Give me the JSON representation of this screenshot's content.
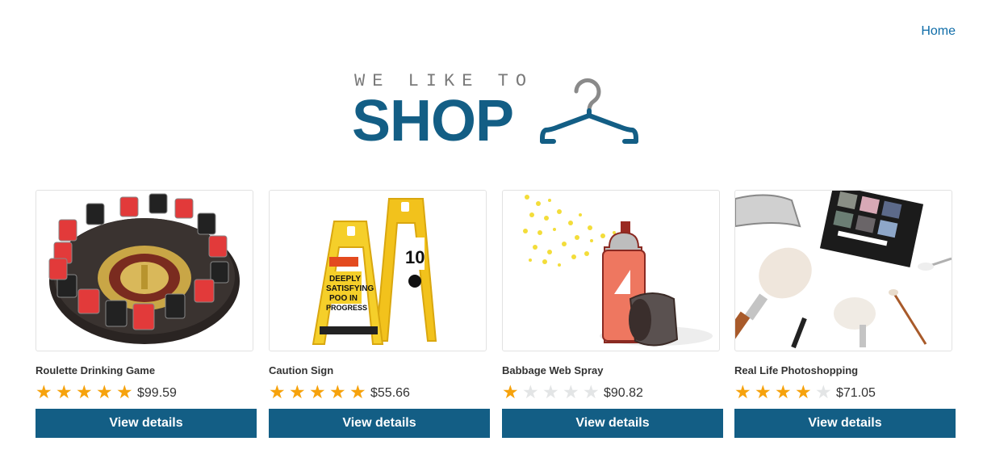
{
  "nav": {
    "home_label": "Home"
  },
  "logo": {
    "tagline": "WE LIKE TO",
    "wordmark": "SHOP",
    "color": "#135e85"
  },
  "accent": "#135e85",
  "star_color": "#f6a20c",
  "products": [
    {
      "name": "Roulette Drinking Game",
      "rating": 5,
      "price": "$99.59",
      "button": "View details",
      "image_icon": "roulette-image"
    },
    {
      "name": "Caution Sign",
      "rating": 5,
      "price": "$55.66",
      "button": "View details",
      "image_icon": "caution-sign-image"
    },
    {
      "name": "Babbage Web Spray",
      "rating": 1,
      "price": "$90.82",
      "button": "View details",
      "image_icon": "spray-can-image"
    },
    {
      "name": "Real Life Photoshopping",
      "rating": 4,
      "price": "$71.05",
      "button": "View details",
      "image_icon": "makeup-image"
    }
  ]
}
